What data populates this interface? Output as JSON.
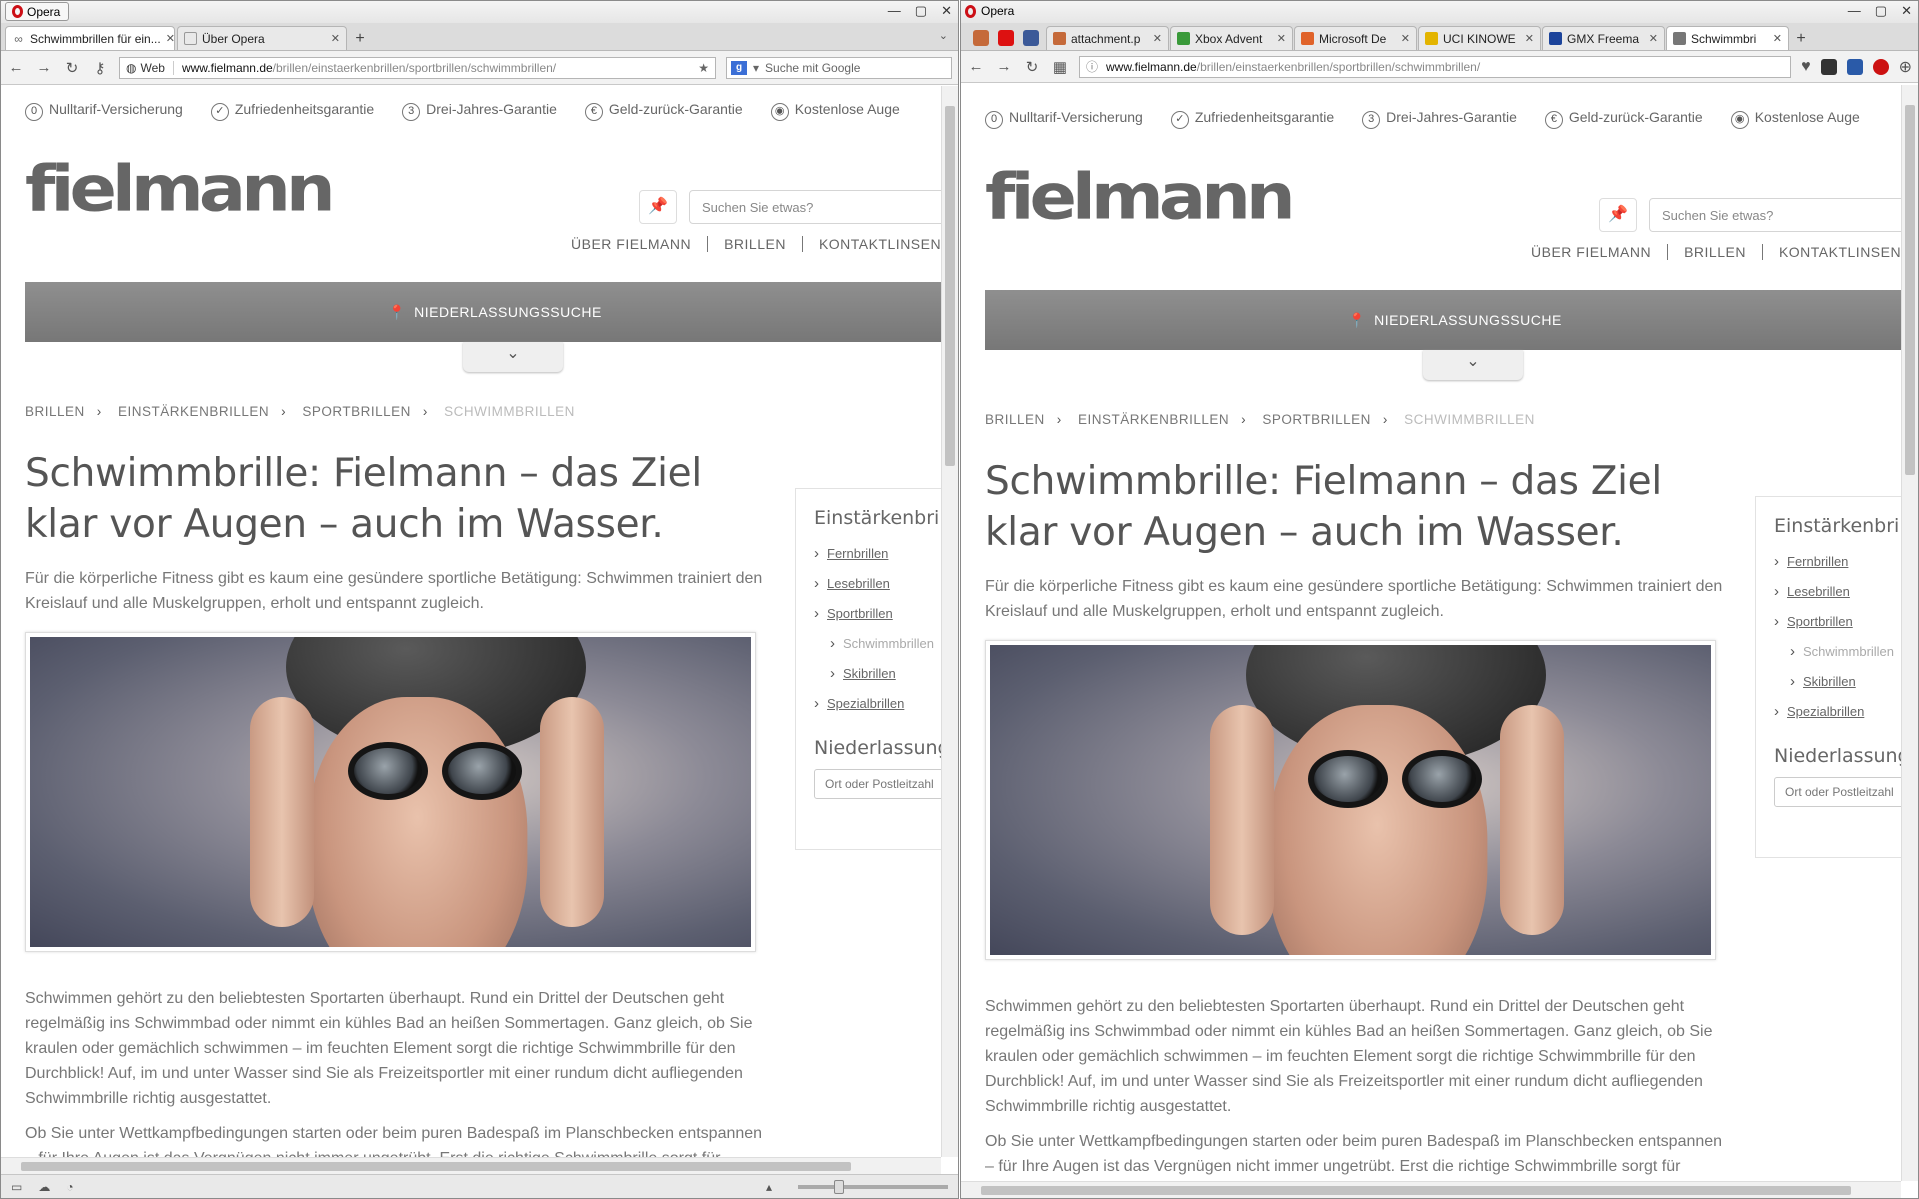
{
  "left": {
    "title": "Opera",
    "tabs": [
      {
        "label": "Schwimmbrillen für ein...",
        "active": true
      },
      {
        "label": "Über Opera",
        "active": false
      }
    ],
    "web_label": "Web",
    "url_host": "www.fielmann.de",
    "url_path": "/brillen/einstaerkenbrillen/sportbrillen/schwimmbrillen/",
    "search_placeholder": "Suche mit Google"
  },
  "right": {
    "title": "Opera",
    "tabs": [
      {
        "label": "attachment.p",
        "color": "#c56a3a"
      },
      {
        "label": "Xbox Advent",
        "color": "#3a9a3a"
      },
      {
        "label": "Microsoft De",
        "color": "#e0632a"
      },
      {
        "label": "UCI KINOWE",
        "color": "#e3b400"
      },
      {
        "label": "GMX Freema",
        "color": "#1c449b"
      },
      {
        "label": "Schwimmbri",
        "color": "#777777"
      }
    ],
    "url_host": "www.fielmann.de",
    "url_path": "/brillen/einstaerkenbrillen/sportbrillen/schwimmbrillen/"
  },
  "page": {
    "usps": [
      {
        "icon": "0",
        "label": "Nulltarif-Versicherung"
      },
      {
        "icon": "✓",
        "label": "Zufriedenheitsgarantie"
      },
      {
        "icon": "3",
        "label": "Drei-Jahres-Garantie"
      },
      {
        "icon": "€",
        "label": "Geld-zurück-Garantie"
      },
      {
        "icon": "◉",
        "label": "Kostenlose Auge"
      }
    ],
    "logo": "fielmann",
    "search_placeholder": "Suchen Sie etwas?",
    "nav": [
      "ÜBER FIELMANN",
      "BRILLEN",
      "KONTAKTLINSEN"
    ],
    "store_search": "NIEDERLASSUNGSSUCHE",
    "breadcrumbs": [
      "BRILLEN",
      "EINSTÄRKENBRILLEN",
      "SPORTBRILLEN",
      "SCHWIMMBRILLEN"
    ],
    "title": "Schwimmbrille: Fielmann – das Ziel klar vor Augen – auch im Wasser.",
    "intro": "Für die körperliche Fitness gibt es kaum eine gesündere sportliche Betätigung: Schwimmen trainiert den Kreislauf und alle Muskelgruppen, erholt und entspannt zugleich.",
    "para1": "Schwimmen gehört zu den beliebtesten Sportarten überhaupt. Rund ein Drittel der Deutschen geht regelmäßig ins Schwimmbad oder nimmt ein kühles Bad an heißen Sommertagen. Ganz gleich, ob Sie kraulen oder gemächlich schwimmen – im feuchten Element sorgt die richtige Schwimmbrille für den Durchblick! Auf, im und unter Wasser sind Sie als Freizeitsportler mit einer rundum dicht aufliegenden Schwimmbrille richtig ausgestattet.",
    "para2": "Ob Sie unter Wettkampfbedingungen starten oder beim puren Badespaß im Planschbecken entspannen – für Ihre Augen ist das Vergnügen nicht immer ungetrübt. Erst die richtige Schwimmbrille sorgt für Schutz in einem Element, das nicht nur aus H2O besteht. Im Hallenbad reizen vor allem Chlor oder Ozon die",
    "sidebar": {
      "heading": "Einstärkenbrillen",
      "items": [
        "Fernbrillen",
        "Lesebrillen",
        "Sportbrillen",
        "Schwimmbrillen",
        "Skibrillen",
        "Spezialbrillen"
      ],
      "store_heading": "Niederlassungen",
      "store_placeholder": "Ort oder Postleitzahl"
    }
  }
}
